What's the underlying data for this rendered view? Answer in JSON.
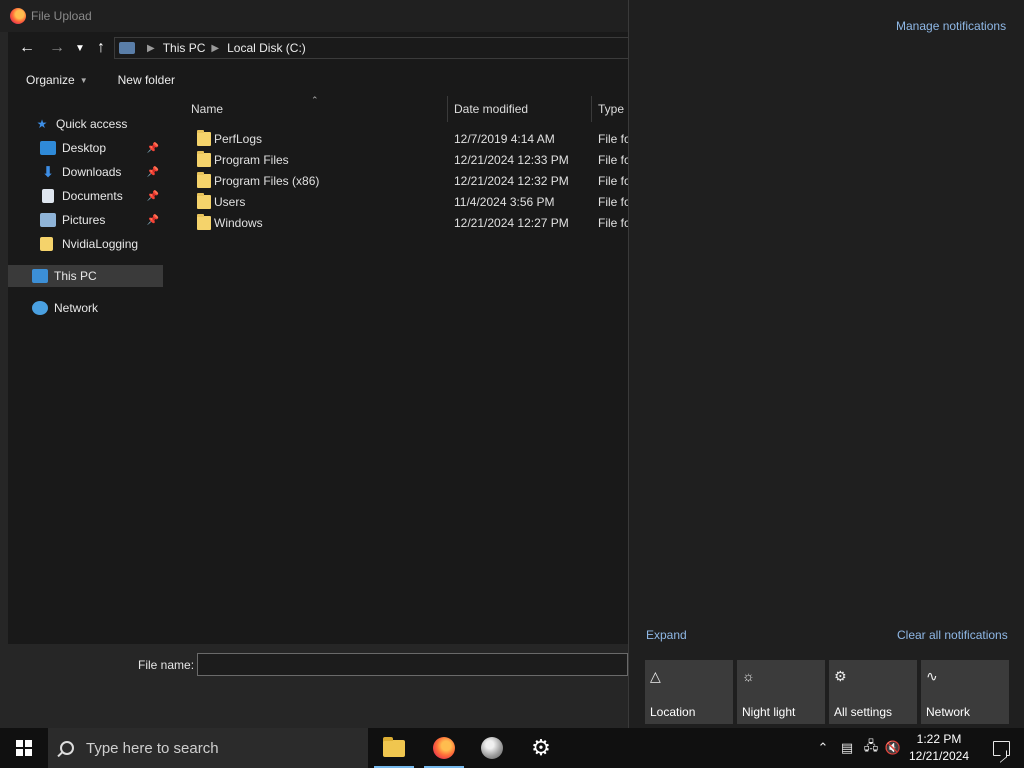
{
  "dialog": {
    "title": "File Upload",
    "address": {
      "parts": [
        "This PC",
        "Local Disk (C:)"
      ]
    },
    "toolbar": {
      "organize": "Organize",
      "new_folder": "New folder"
    },
    "nav_items": [
      {
        "label": "Quick access",
        "icon": "star-icon"
      },
      {
        "label": "Desktop",
        "icon": "desktop-icon",
        "pinned": true
      },
      {
        "label": "Downloads",
        "icon": "download-icon",
        "pinned": true
      },
      {
        "label": "Documents",
        "icon": "document-icon",
        "pinned": true
      },
      {
        "label": "Pictures",
        "icon": "picture-icon",
        "pinned": true
      },
      {
        "label": "NvidiaLogging",
        "icon": "folder-icon"
      },
      {
        "label": "This PC",
        "icon": "computer-icon",
        "selected": true
      },
      {
        "label": "Network",
        "icon": "network-icon"
      }
    ],
    "columns": {
      "name": "Name",
      "date": "Date modified",
      "type": "Type"
    },
    "files": [
      {
        "name": "PerfLogs",
        "date": "12/7/2019 4:14 AM",
        "type": "File folder"
      },
      {
        "name": "Program Files",
        "date": "12/21/2024 12:33 PM",
        "type": "File folder"
      },
      {
        "name": "Program Files (x86)",
        "date": "12/21/2024 12:32 PM",
        "type": "File folder"
      },
      {
        "name": "Users",
        "date": "11/4/2024 3:56 PM",
        "type": "File folder"
      },
      {
        "name": "Windows",
        "date": "12/21/2024 12:27 PM",
        "type": "File folder"
      }
    ],
    "file_name_label": "File name:",
    "file_name_value": ""
  },
  "action_center": {
    "manage": "Manage notifications",
    "expand": "Expand",
    "clear_all": "Clear all notifications",
    "tiles": [
      {
        "label": "Location",
        "icon": "location-icon"
      },
      {
        "label": "Night light",
        "icon": "night-light-icon"
      },
      {
        "label": "All settings",
        "icon": "settings-icon"
      },
      {
        "label": "Network",
        "icon": "network-icon"
      }
    ]
  },
  "taskbar": {
    "search_placeholder": "Type here to search",
    "time": "1:22 PM",
    "date": "12/21/2024"
  }
}
